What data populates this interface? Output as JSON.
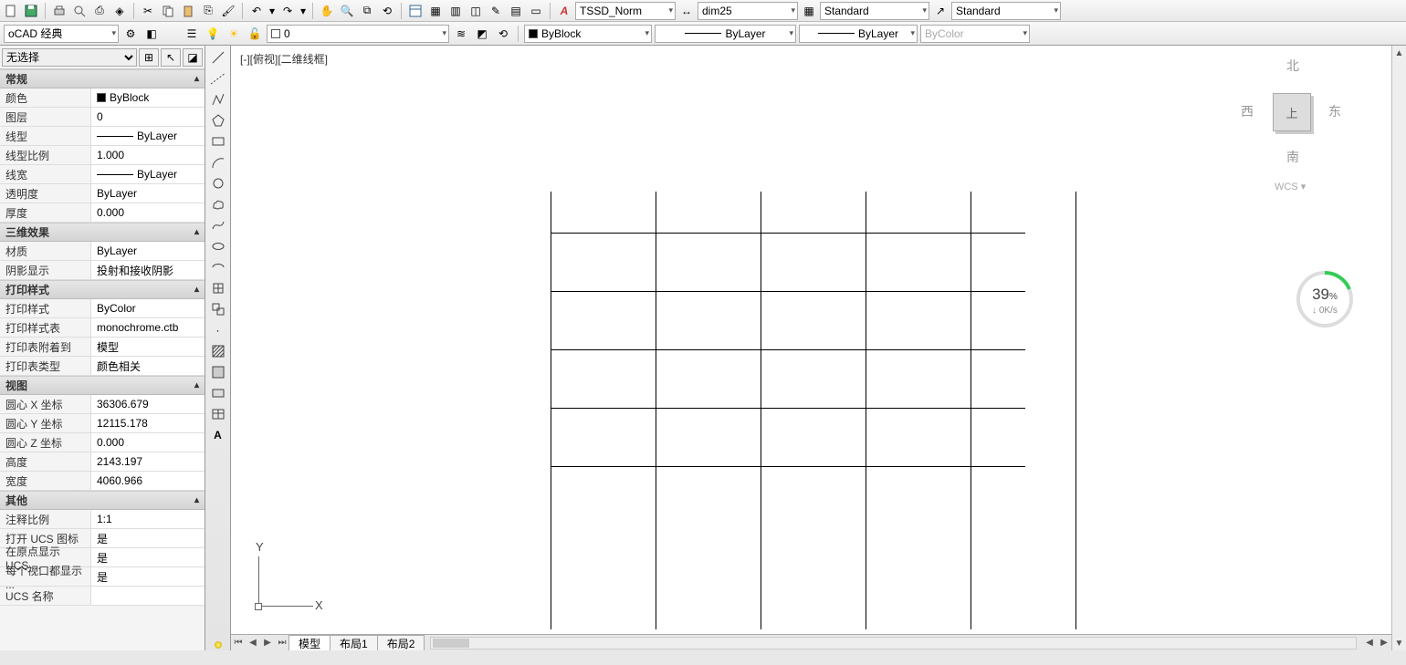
{
  "workspace": {
    "name": "oCAD 经典"
  },
  "toolbar1": {
    "text_style": "TSSD_Norm",
    "dim_style": "dim25",
    "table_style": "Standard",
    "mleader_style": "Standard"
  },
  "toolbar2": {
    "layer": "0",
    "color": "ByBlock",
    "linetype": "ByLayer",
    "lineweight": "ByLayer",
    "plot_style": "ByColor"
  },
  "props": {
    "selection": "无选择",
    "groups": [
      {
        "title": "常规",
        "rows": [
          {
            "k": "颜色",
            "v": "ByBlock",
            "swatch": true
          },
          {
            "k": "图层",
            "v": "0"
          },
          {
            "k": "线型",
            "v": "ByLayer",
            "ltype": true
          },
          {
            "k": "线型比例",
            "v": "1.000"
          },
          {
            "k": "线宽",
            "v": "ByLayer",
            "ltype": true
          },
          {
            "k": "透明度",
            "v": "ByLayer"
          },
          {
            "k": "厚度",
            "v": "0.000"
          }
        ]
      },
      {
        "title": "三维效果",
        "rows": [
          {
            "k": "材质",
            "v": "ByLayer"
          },
          {
            "k": "阴影显示",
            "v": "投射和接收阴影"
          }
        ]
      },
      {
        "title": "打印样式",
        "rows": [
          {
            "k": "打印样式",
            "v": "ByColor"
          },
          {
            "k": "打印样式表",
            "v": "monochrome.ctb"
          },
          {
            "k": "打印表附着到",
            "v": "模型"
          },
          {
            "k": "打印表类型",
            "v": "颜色相关"
          }
        ]
      },
      {
        "title": "视图",
        "rows": [
          {
            "k": "圆心 X 坐标",
            "v": "36306.679"
          },
          {
            "k": "圆心 Y 坐标",
            "v": "12115.178"
          },
          {
            "k": "圆心 Z 坐标",
            "v": "0.000"
          },
          {
            "k": "高度",
            "v": "2143.197"
          },
          {
            "k": "宽度",
            "v": "4060.966"
          }
        ]
      },
      {
        "title": "其他",
        "rows": [
          {
            "k": "注释比例",
            "v": "1:1"
          },
          {
            "k": "打开 UCS 图标",
            "v": "是"
          },
          {
            "k": "在原点显示 UCS ...",
            "v": "是"
          },
          {
            "k": "每个视口都显示 ...",
            "v": "是"
          },
          {
            "k": "UCS 名称",
            "v": ""
          }
        ]
      }
    ]
  },
  "viewport": {
    "label_min": "[-]",
    "label_view": "[俯视]",
    "label_style": "[二维线框]"
  },
  "viewcube": {
    "n": "北",
    "s": "南",
    "e": "东",
    "w": "西",
    "top": "上",
    "wcs": "WCS ▾"
  },
  "ucs": {
    "y": "Y",
    "x": "X"
  },
  "net": {
    "percent": "39",
    "unit": "%",
    "arrow": "↓",
    "rate": "0K/s"
  },
  "tabs": {
    "model": "模型",
    "layout1": "布局1",
    "layout2": "布局2"
  }
}
